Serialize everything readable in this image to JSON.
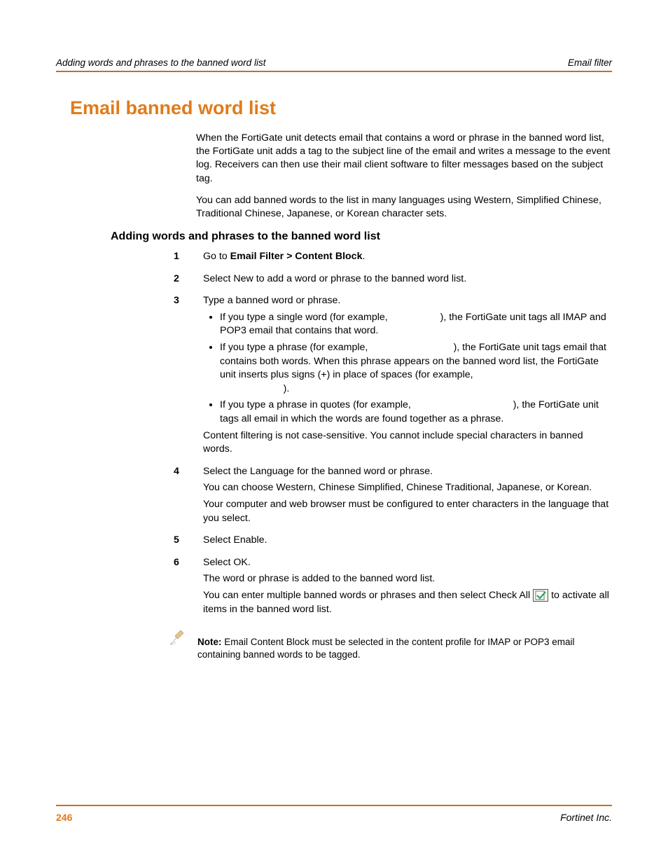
{
  "header": {
    "left": "Adding words and phrases to the banned word list",
    "right": "Email filter"
  },
  "title": "Email banned word list",
  "intro": {
    "p1": "When the FortiGate unit detects email that contains a word or phrase in the banned word list, the FortiGate unit adds a tag to the subject line of the email and writes a message to the event log. Receivers can then use their mail client software to filter messages based on the subject tag.",
    "p2": "You can add banned words to the list in many languages using Western, Simplified Chinese, Traditional Chinese, Japanese, or Korean character sets."
  },
  "subheading": "Adding words and phrases to the banned word list",
  "steps": {
    "s1": {
      "num": "1",
      "pre": "Go to ",
      "bold": "Email Filter > Content Block",
      "post": "."
    },
    "s2": {
      "num": "2",
      "text": "Select New to add a word or phrase to the banned word list."
    },
    "s3": {
      "num": "3",
      "lead": "Type a banned word or phrase.",
      "b1": "If you type a single word (for example, ",
      "b1b": "), the FortiGate unit tags all IMAP and POP3 email that contains that word.",
      "b2": "If you type a phrase (for example, ",
      "b2b": "), the FortiGate unit tags email that contains both words. When this phrase appears on the banned word list, the FortiGate unit inserts plus signs (+) in place of spaces (for example, ",
      "b2c": ").",
      "b3": "If you type a phrase in quotes (for example, ",
      "b3b": "), the FortiGate unit tags all email in which the words are found together as a phrase.",
      "tail": "Content filtering is not case-sensitive. You cannot include special characters in banned words."
    },
    "s4": {
      "num": "4",
      "l1": "Select the Language for the banned word or phrase.",
      "l2": "You can choose Western, Chinese Simplified, Chinese Traditional, Japanese, or Korean.",
      "l3": "Your computer and web browser must be configured to enter characters in the language that you select."
    },
    "s5": {
      "num": "5",
      "text": "Select Enable."
    },
    "s6": {
      "num": "6",
      "l1": "Select OK.",
      "l2": "The word or phrase is added to the banned word list.",
      "l3a": "You can enter multiple banned words or phrases and then select Check All ",
      "l3b": " to activate all items in the banned word list."
    }
  },
  "note": {
    "label": "Note:",
    "text": " Email Content Block must be selected in the content profile for IMAP or POP3 email containing banned words to be tagged."
  },
  "footer": {
    "page": "246",
    "company": "Fortinet Inc."
  },
  "gaps": {
    "g1": "                  ",
    "g2": "                              ",
    "g3": "                       ",
    "g4": "                                    "
  }
}
